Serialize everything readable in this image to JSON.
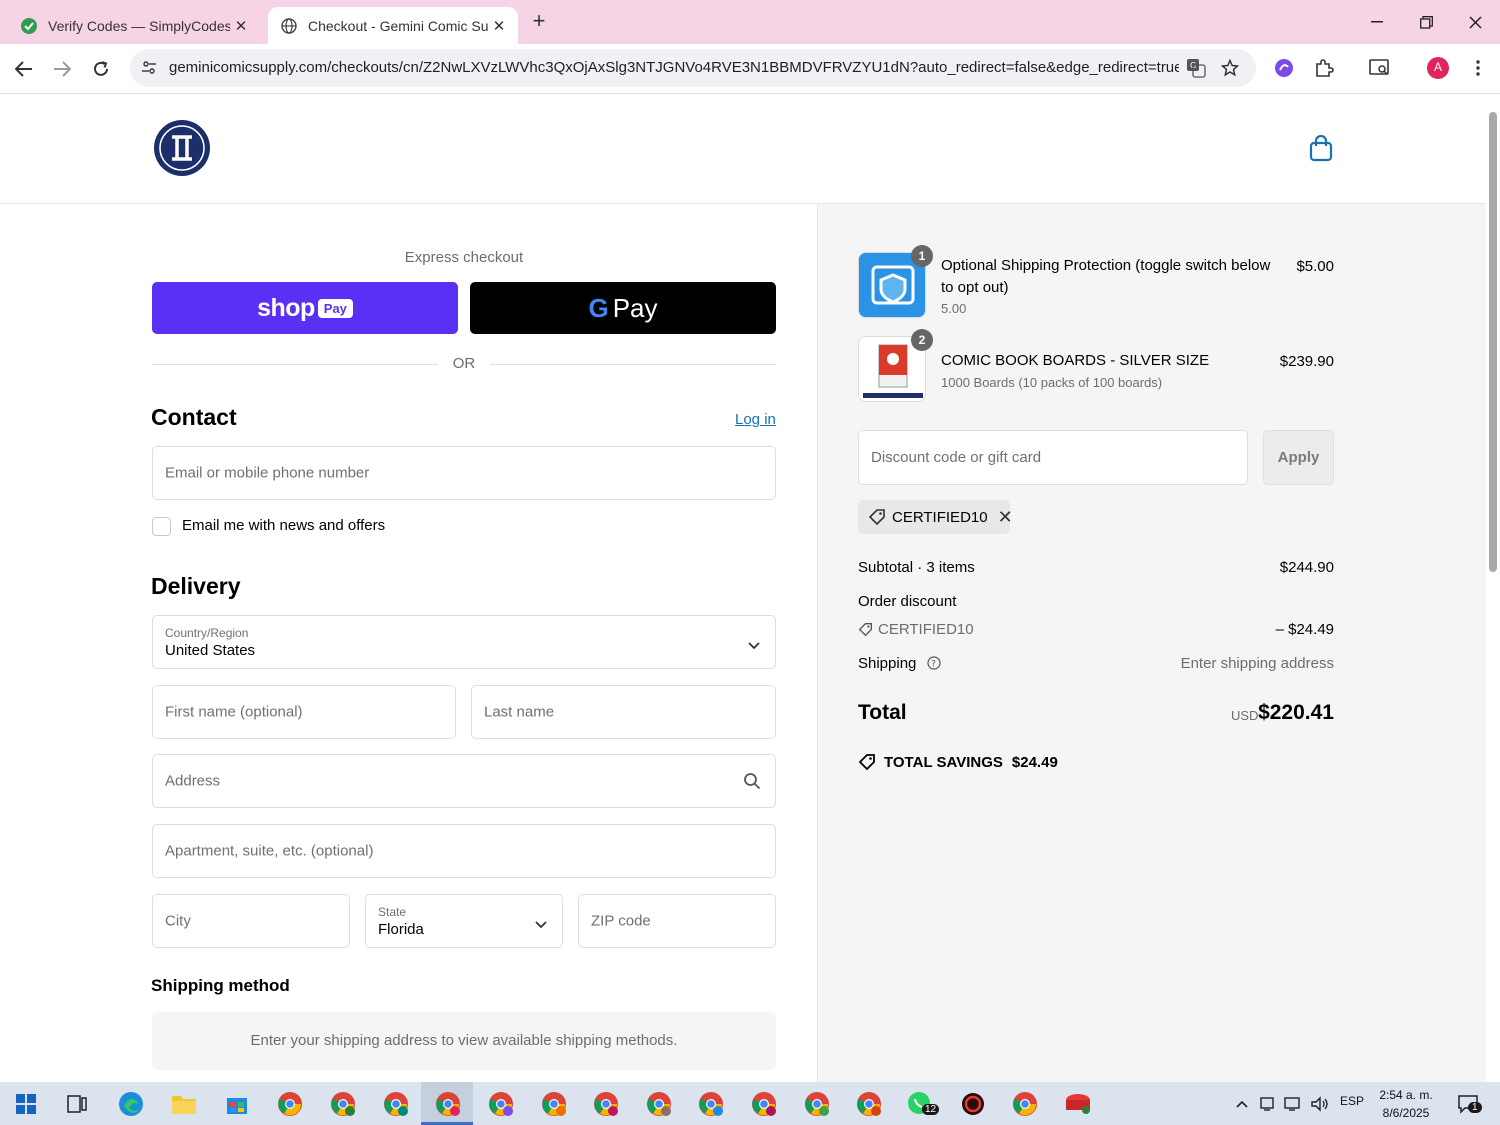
{
  "browser": {
    "tabs": [
      {
        "title": "Verify Codes — SimplyCodes",
        "active": false
      },
      {
        "title": "Checkout - Gemini Comic Supp",
        "active": true
      }
    ],
    "url": "geminicomicsupply.com/checkouts/cn/Z2NwLXVzLWVhc3QxOjAxSlg3NTJGNVo4RVE3N1BBMDVFRVZYU1dN?auto_redirect=false&edge_redirect=true...",
    "profile_initial": "A"
  },
  "checkout": {
    "express_label": "Express checkout",
    "shop_pay": {
      "shop": "shop",
      "pay": "Pay"
    },
    "gpay": {
      "g": "G",
      "pay": "Pay"
    },
    "or_label": "OR",
    "contact": {
      "title": "Contact",
      "login_link": "Log in",
      "email_placeholder": "Email or mobile phone number",
      "newsletter_label": "Email me with news and offers"
    },
    "delivery": {
      "title": "Delivery",
      "country_label": "Country/Region",
      "country_value": "United States",
      "first_name_placeholder": "First name (optional)",
      "last_name_placeholder": "Last name",
      "address_placeholder": "Address",
      "apartment_placeholder": "Apartment, suite, etc. (optional)",
      "city_placeholder": "City",
      "state_label": "State",
      "state_value": "Florida",
      "zip_placeholder": "ZIP code"
    },
    "shipping_method": {
      "title": "Shipping method",
      "message": "Enter your shipping address to view available shipping methods."
    }
  },
  "summary": {
    "items": [
      {
        "quantity": "1",
        "name": "Optional Shipping Protection (toggle switch below to opt out)",
        "variant": "5.00",
        "price": "$5.00"
      },
      {
        "quantity": "2",
        "name": "COMIC BOOK BOARDS - SILVER SIZE",
        "variant": "1000 Boards (10 packs of 100 boards)",
        "price": "$239.90"
      }
    ],
    "discount_placeholder": "Discount code or gift card",
    "apply_label": "Apply",
    "applied_code": "CERTIFIED10",
    "subtotal_label": "Subtotal · 3 items",
    "subtotal_value": "$244.90",
    "order_discount_label": "Order discount",
    "order_discount_code": "CERTIFIED10",
    "order_discount_value": "– $24.49",
    "shipping_label": "Shipping",
    "shipping_value": "Enter shipping address",
    "total_label": "Total",
    "total_currency": "USD",
    "total_value": "$220.41",
    "savings_label": "TOTAL SAVINGS",
    "savings_value": "$24.49"
  },
  "taskbar": {
    "language": "ESP",
    "time": "2:54 a. m.",
    "date": "8/6/2025",
    "whatsapp_badge": "12",
    "notification_badge": "1"
  },
  "colors": {
    "tabbar_bg": "#f7d3e6",
    "shop_pay": "#5a31f4",
    "link": "#1773b0",
    "logo_navy": "#1c2f6b",
    "bag_icon": "#1773b0"
  }
}
